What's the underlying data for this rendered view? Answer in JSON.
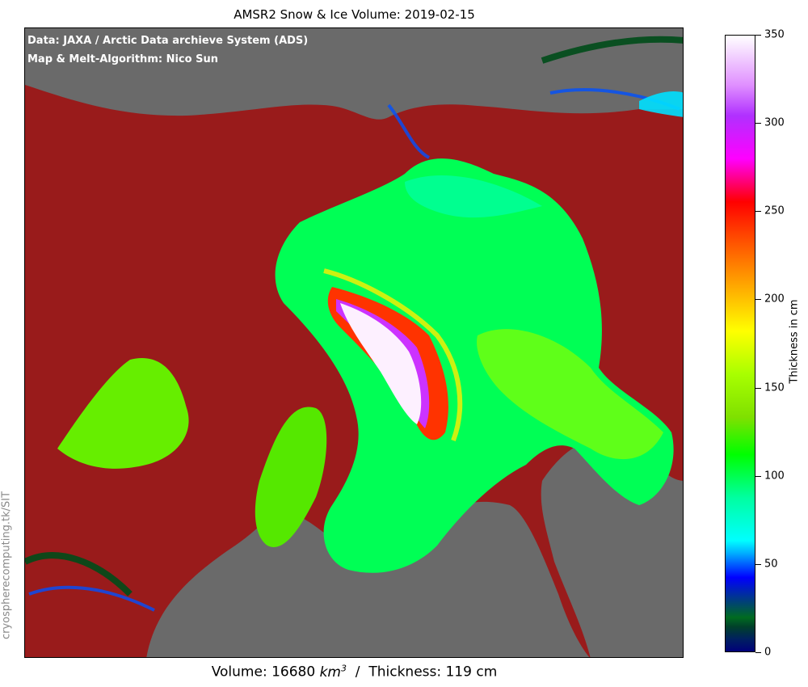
{
  "title": "AMSR2 Snow & Ice Volume: 2019-02-15",
  "credits": {
    "data": "Data: JAXA / Arctic Data archieve System (ADS)",
    "algorithm": "Map & Melt-Algorithm: Nico Sun"
  },
  "watermark": "cryospherecomputing.tk/SIT",
  "footer": {
    "volume_label": "Volume: 16680",
    "volume_unit_base": "km",
    "volume_unit_exp": "3",
    "separator": "/",
    "thickness_text": "Thickness: 119 cm"
  },
  "colorbar": {
    "label": "Thickness in cm",
    "min": 0,
    "max": 350,
    "ticks": [
      "0",
      "50",
      "100",
      "150",
      "200",
      "250",
      "300",
      "350"
    ]
  },
  "colors": {
    "land": "#991b1b",
    "ocean": "#6a6a6a",
    "ice_thin": "#00ff80",
    "ice_medium": "#66ee00",
    "ice_thick": "#ff3300",
    "ice_max": "#fdf0ff",
    "ice_edge": "#004d1a"
  }
}
